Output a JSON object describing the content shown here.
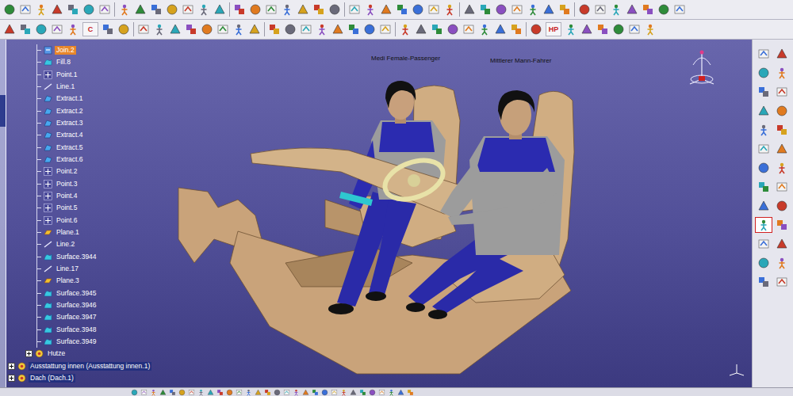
{
  "tree": {
    "items": [
      {
        "label": "Join.2",
        "kind": "join",
        "selected": true
      },
      {
        "label": "Fill.8",
        "kind": "fill",
        "selected": false
      },
      {
        "label": "Point.1",
        "kind": "point",
        "selected": false
      },
      {
        "label": "Line.1",
        "kind": "line",
        "selected": false
      },
      {
        "label": "Extract.1",
        "kind": "extract",
        "selected": false
      },
      {
        "label": "Extract.2",
        "kind": "extract",
        "selected": false
      },
      {
        "label": "Extract.3",
        "kind": "extract",
        "selected": false
      },
      {
        "label": "Extract.4",
        "kind": "extract",
        "selected": false
      },
      {
        "label": "Extract.5",
        "kind": "extract",
        "selected": false
      },
      {
        "label": "Extract.6",
        "kind": "extract",
        "selected": false
      },
      {
        "label": "Point.2",
        "kind": "point",
        "selected": false
      },
      {
        "label": "Point.3",
        "kind": "point",
        "selected": false
      },
      {
        "label": "Point.4",
        "kind": "point",
        "selected": false
      },
      {
        "label": "Point.5",
        "kind": "point",
        "selected": false
      },
      {
        "label": "Point.6",
        "kind": "point",
        "selected": false
      },
      {
        "label": "Plane.1",
        "kind": "plane",
        "selected": false
      },
      {
        "label": "Line.2",
        "kind": "line",
        "selected": false
      },
      {
        "label": "Surface.3944",
        "kind": "surface",
        "selected": false
      },
      {
        "label": "Line.17",
        "kind": "line",
        "selected": false
      },
      {
        "label": "Plane.3",
        "kind": "plane",
        "selected": false
      },
      {
        "label": "Surface.3945",
        "kind": "surface",
        "selected": false
      },
      {
        "label": "Surface.3946",
        "kind": "surface",
        "selected": false
      },
      {
        "label": "Surface.3947",
        "kind": "surface",
        "selected": false
      },
      {
        "label": "Surface.3948",
        "kind": "surface",
        "selected": false
      },
      {
        "label": "Surface.3949",
        "kind": "surface",
        "selected": false
      }
    ],
    "subnode": {
      "label": "Hutze",
      "expanded": false
    },
    "nodes": [
      {
        "label": "Ausstattung innen (Ausstattung innen.1)",
        "expanded": false
      },
      {
        "label": "Dach (Dach.1)",
        "expanded": false
      }
    ]
  },
  "toolbar": {
    "row2_texts": [
      "C",
      "HP"
    ]
  },
  "manikins": [
    {
      "label": "Medi Female-Passenger"
    },
    {
      "label": "Mittlerer Mann-Fahrer"
    }
  ],
  "right_tools": [
    {
      "selected": false
    },
    {
      "selected": false
    },
    {
      "selected": false
    },
    {
      "selected": false
    },
    {
      "selected": false
    },
    {
      "selected": false
    },
    {
      "selected": false
    },
    {
      "selected": false
    },
    {
      "selected": false
    },
    {
      "selected": false
    },
    {
      "selected": false
    },
    {
      "selected": false
    },
    {
      "selected": false
    },
    {
      "selected": false
    },
    {
      "selected": false
    },
    {
      "selected": false
    },
    {
      "selected": false
    },
    {
      "selected": false
    },
    {
      "selected": true
    },
    {
      "selected": false
    },
    {
      "selected": false
    },
    {
      "selected": false
    },
    {
      "selected": false
    },
    {
      "selected": false
    },
    {
      "selected": false
    },
    {
      "selected": false
    }
  ]
}
